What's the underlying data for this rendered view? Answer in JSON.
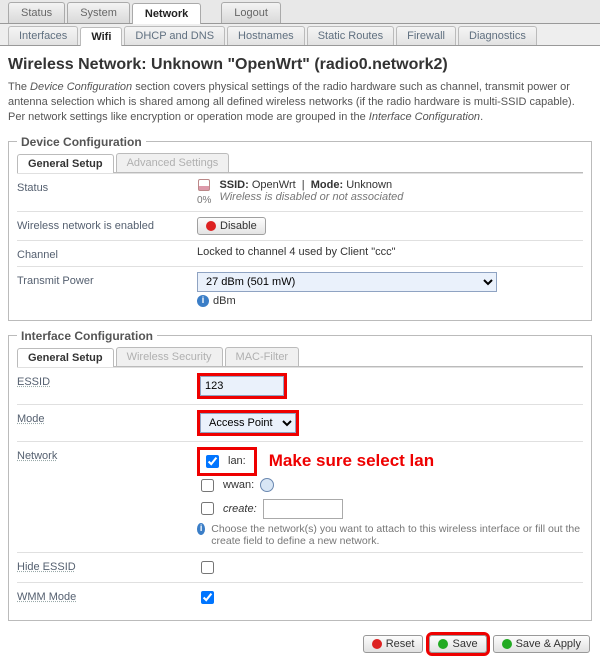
{
  "main_tabs": {
    "status": "Status",
    "system": "System",
    "network": "Network",
    "logout": "Logout"
  },
  "sub_tabs": {
    "interfaces": "Interfaces",
    "wifi": "Wifi",
    "dhcp": "DHCP and DNS",
    "hostnames": "Hostnames",
    "static": "Static Routes",
    "firewall": "Firewall",
    "diagnostics": "Diagnostics"
  },
  "page_title": "Wireless Network: Unknown \"OpenWrt\" (radio0.network2)",
  "intro": {
    "p1a": "The ",
    "p1b": "Device Configuration",
    "p1c": " section covers physical settings of the radio hardware such as channel, transmit power or antenna selection which is shared among all defined wireless networks (if the radio hardware is multi-SSID capable). Per network settings like encryption or operation mode are grouped in the ",
    "p1d": "Interface Configuration",
    "p1e": "."
  },
  "deviceConfig": {
    "legend": "Device Configuration",
    "tabs": {
      "general": "General Setup",
      "advanced": "Advanced Settings"
    },
    "status_label": "Status",
    "status": {
      "ssid_label": "SSID:",
      "ssid": "OpenWrt",
      "mode_label": "Mode:",
      "mode": "Unknown",
      "pct": "0%",
      "msg": "Wireless is disabled or not associated"
    },
    "enabled_label": "Wireless network is enabled",
    "disable_btn": "Disable",
    "channel_label": "Channel",
    "channel_value": "Locked to channel 4 used by Client \"ccc\"",
    "txpower_label": "Transmit Power",
    "txpower_value": "27 dBm (501 mW)",
    "txpower_unit": "dBm"
  },
  "ifaceConfig": {
    "legend": "Interface Configuration",
    "tabs": {
      "general": "General Setup",
      "security": "Wireless Security",
      "mac": "MAC-Filter"
    },
    "essid_label": "ESSID",
    "essid_value": "123",
    "mode_label": "Mode",
    "mode_value": "Access Point",
    "network_label": "Network",
    "networks": {
      "lan": {
        "label": "lan:",
        "checked": true
      },
      "wwan": {
        "label": "wwan:",
        "checked": false
      },
      "create": {
        "label": "create:",
        "checked": false
      }
    },
    "network_hint": "Choose the network(s) you want to attach to this wireless interface or fill out the create field to define a new network.",
    "hide_essid_label": "Hide ESSID",
    "hide_essid": false,
    "wmm_label": "WMM Mode",
    "wmm": true
  },
  "annotation": "Make sure select lan",
  "buttons": {
    "reset": "Reset",
    "save": "Save",
    "save_apply": "Save & Apply"
  }
}
